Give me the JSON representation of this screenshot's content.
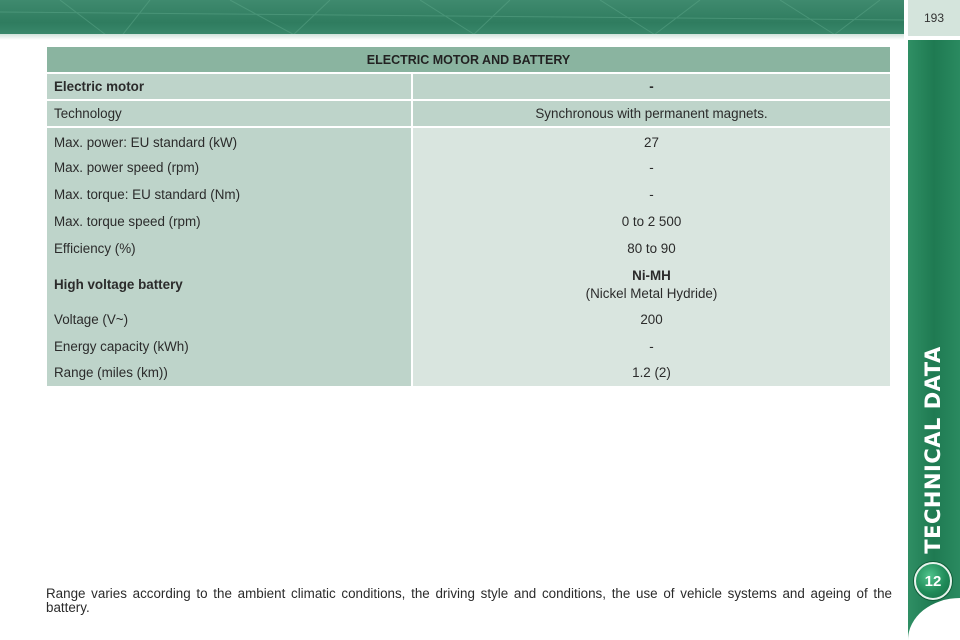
{
  "header": {
    "page_number": "193"
  },
  "side_tab": {
    "title": "TECHNICAL DATA",
    "chapter_number": "12"
  },
  "table": {
    "title": "ELECTRIC MOTOR AND BATTERY",
    "head": {
      "label": "Electric motor",
      "value": "-"
    },
    "technology": {
      "label": "Technology",
      "value": "Synchronous with permanent magnets."
    },
    "rows": [
      {
        "label": "Max. power: EU standard (kW)",
        "value": "27"
      },
      {
        "label": "Max. power speed (rpm)",
        "value": "-"
      },
      {
        "label": "Max. torque: EU standard (Nm)",
        "value": "-"
      },
      {
        "label": "Max. torque speed (rpm)",
        "value": "0 to 2 500"
      },
      {
        "label": "Efficiency (%)",
        "value": "80 to 90"
      }
    ],
    "battery": {
      "label": "High voltage battery",
      "value": "Ni-MH",
      "value_sub": "(Nickel Metal Hydride)"
    },
    "battery_rows": [
      {
        "label": "Voltage (V~)",
        "value": "200"
      },
      {
        "label": "Energy capacity (kWh)",
        "value": "-"
      },
      {
        "label": "Range (miles (km))",
        "value": "1.2 (2)"
      }
    ]
  },
  "footnote": "Range varies according to the ambient climatic conditions, the driving style and conditions, the use of vehicle systems and ageing of the battery.",
  "colors": {
    "header_green": "#2f7c5f",
    "side_tab_green": "#1f7a52",
    "table_title_bg": "#8ab4a0",
    "label_col_bg": "#bed4ca",
    "value_col_bg": "#d9e5df"
  }
}
